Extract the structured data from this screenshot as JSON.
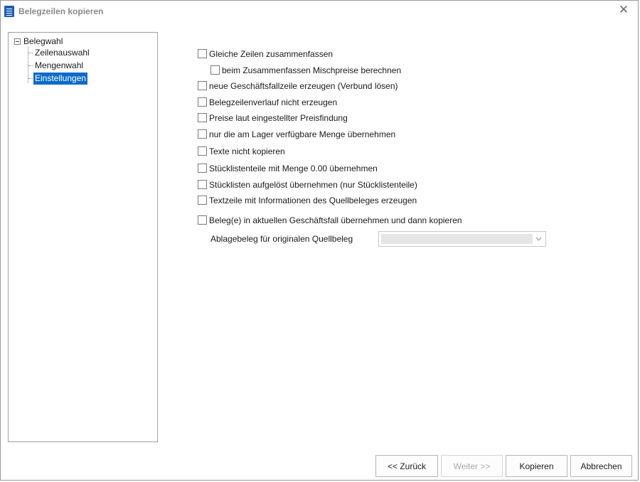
{
  "window": {
    "title": "Belegzeilen kopieren",
    "close_symbol": "✕"
  },
  "tree": {
    "root_label": "Belegwahl",
    "items": [
      {
        "label": "Zeilenauswahl",
        "selected": false
      },
      {
        "label": "Mengenwahl",
        "selected": false
      },
      {
        "label": "Einstellungen",
        "selected": true
      }
    ]
  },
  "options": [
    {
      "label": "Gleiche Zeilen zusammenfassen",
      "checked": false
    },
    {
      "label": "beim Zusammenfassen Mischpreise berechnen",
      "checked": false
    },
    {
      "label": "neue Geschäftsfallzeile erzeugen (Verbund lösen)",
      "checked": false
    },
    {
      "label": "Belegzeilenverlauf nicht erzeugen",
      "checked": false
    },
    {
      "label": "Preise laut eingestellter Preisfindung",
      "checked": false
    },
    {
      "label": "nur die am Lager verfügbare Menge übernehmen",
      "checked": false
    },
    {
      "label": "Texte nicht kopieren",
      "checked": false
    },
    {
      "label": "Stücklistenteile mit Menge 0.00 übernehmen",
      "checked": false
    },
    {
      "label": "Stücklisten aufgelöst übernehmen (nur Stücklistenteile)",
      "checked": false
    },
    {
      "label": "Textzeile mit Informationen des Quellbeleges erzeugen",
      "checked": false
    },
    {
      "label": "Beleg(e) in aktuellen Geschäftsfall übernehmen und dann kopieren",
      "checked": false
    }
  ],
  "ablage": {
    "label": "Ablagebeleg für originalen Quellbeleg",
    "value": "",
    "disabled": true
  },
  "buttons": {
    "back": "<< Zurück",
    "next": "Weiter >>",
    "copy": "Kopieren",
    "cancel": "Abbrechen"
  },
  "colors": {
    "selection": "#0b6bc8",
    "icon": "#1a5fb4"
  }
}
